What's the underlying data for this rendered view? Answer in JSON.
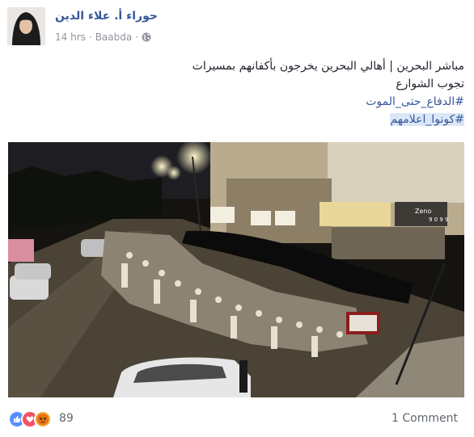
{
  "post": {
    "author": "حوراء أ. علاء الدين",
    "time": "14 hrs",
    "separator": "·",
    "location": "Baabda",
    "privacy_icon": "globe-icon",
    "text_lines": [
      "مباشر البحرين | أهالي البحرين يخرجون بأكفانهم بمسيرات",
      "تجوب الشوارع"
    ],
    "hashtags": [
      "#الدفاع_حتى_الموت",
      "#كونوا_اعلامهم"
    ],
    "photo_signs": {
      "shop_sign": "Zeno",
      "shop_number": "9 0 9 9"
    },
    "reactions": [
      "like-icon",
      "love-icon",
      "angry-icon"
    ],
    "reaction_count": "89",
    "comments": "1 Comment",
    "colors": {
      "link": "#365899",
      "meta": "#90949c",
      "hashtag_highlight": "#dbe6f7"
    }
  }
}
